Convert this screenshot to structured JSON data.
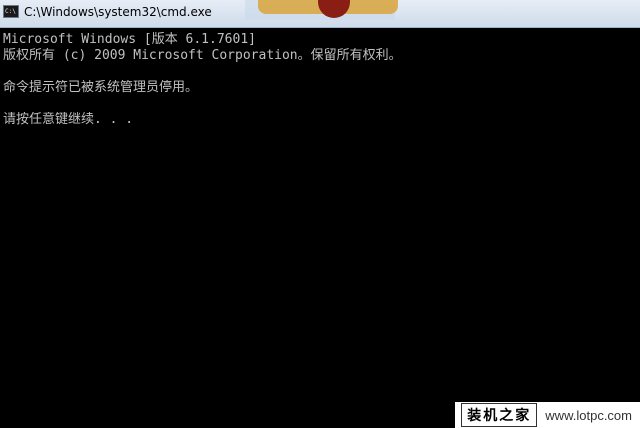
{
  "window": {
    "title": "C:\\Windows\\system32\\cmd.exe",
    "icon": "cmd-console-icon",
    "icon_text": "C:\\"
  },
  "console": {
    "lines": [
      "Microsoft Windows [版本 6.1.7601]",
      "版权所有 (c) 2009 Microsoft Corporation。保留所有权利。",
      "",
      "命令提示符已被系统管理员停用。",
      "",
      "请按任意键继续. . ."
    ],
    "text_color": "#c0c0c0",
    "background_color": "#000000"
  },
  "watermark": {
    "logo_text": "装机之家",
    "url": "www.lotpc.com"
  }
}
